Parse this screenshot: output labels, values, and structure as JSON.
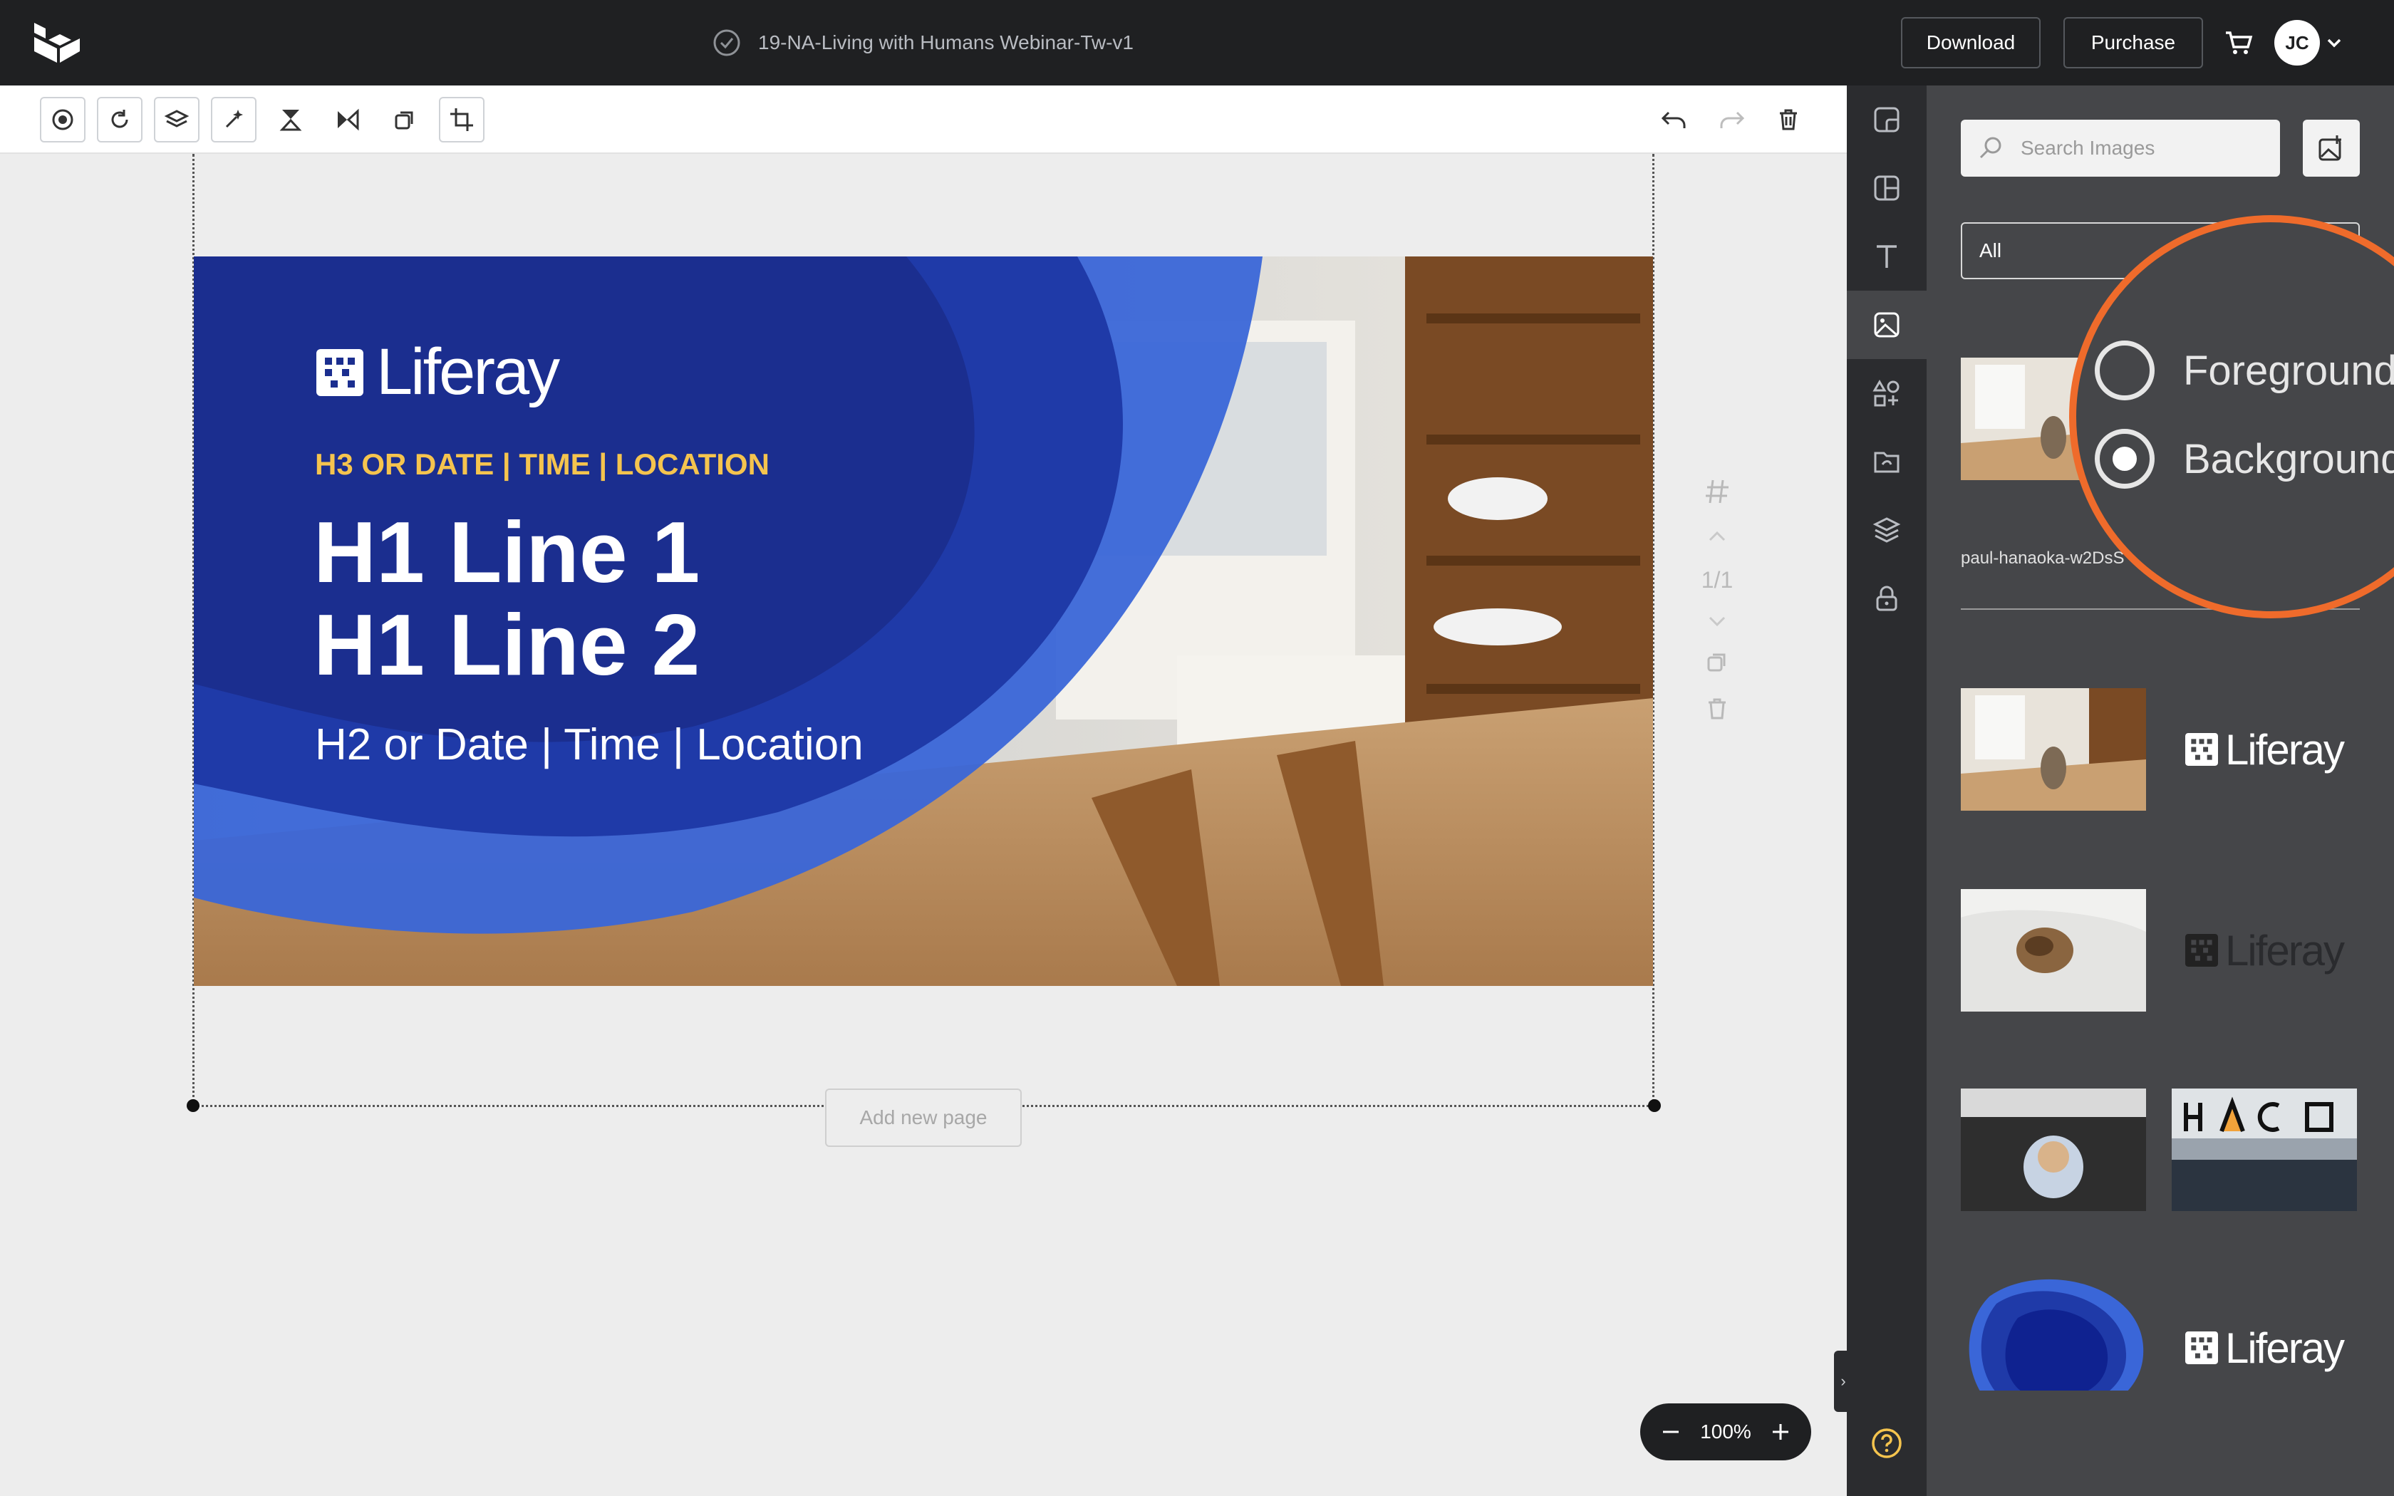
{
  "document": {
    "title": "19-NA-Living with Humans Webinar-Tw-v1"
  },
  "header": {
    "download_label": "Download",
    "purchase_label": "Purchase",
    "user_initials": "JC"
  },
  "banner": {
    "brand": "Liferay",
    "h3": "H3 OR DATE | TIME | LOCATION",
    "h1_line1": "H1 Line 1",
    "h1_line2": "H1 Line 2",
    "h2": "H2 or Date | Time | Location"
  },
  "canvas": {
    "add_page_label": "Add new page",
    "page_indicator": "1/1"
  },
  "zoom": {
    "level": "100%"
  },
  "panel": {
    "search_placeholder": "Search Images",
    "filter_value": "All",
    "image_name": "paul-hanaoka-w2DsS",
    "magnifier_options": {
      "foreground": "Foreground",
      "background": "Background",
      "selected": "background"
    },
    "logo_text": "Liferay"
  },
  "colors": {
    "accent": "#ef6b2b",
    "brand_blue": "#1b2e8f",
    "h3_yellow": "#f5c44e"
  }
}
